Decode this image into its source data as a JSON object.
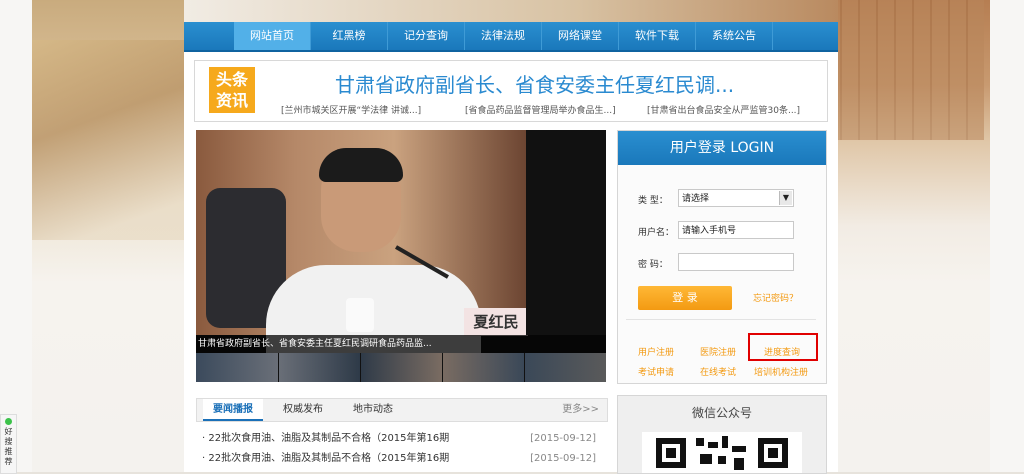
{
  "nav": {
    "items": [
      "网站首页",
      "红黑榜",
      "记分查询",
      "法律法规",
      "网络课堂",
      "软件下载",
      "系统公告"
    ],
    "active_index": 0
  },
  "headline": {
    "badge_line1": "头条",
    "badge_line2": "资讯",
    "title": "甘肃省政府副省长、省食安委主任夏红民调...",
    "subs": [
      "[兰州市城关区开展“学法律 讲诚...]",
      "[省食品药品监督管理局举办食品生...]",
      "[甘肃省出台食品安全从严监管30条...]"
    ]
  },
  "slideshow": {
    "nameplate": "夏红民",
    "caption": "甘肃省政府副省长、省食安委主任夏红民调研食品药品监..."
  },
  "news_tabs": {
    "tabs": [
      "要闻播报",
      "权威发布",
      "地市动态"
    ],
    "active_index": 0,
    "more": "更多>>",
    "items": [
      {
        "title": "· 22批次食用油、油脂及其制品不合格（2015年第16期",
        "date": "[2015-09-12]"
      },
      {
        "title": "· 22批次食用油、油脂及其制品不合格（2015年第16期",
        "date": "[2015-09-12]"
      }
    ]
  },
  "login": {
    "title": "用户登录 LOGIN",
    "type_label": "类  型：",
    "type_value": "请选择",
    "username_label": "用户名：",
    "username_value": "请输入手机号",
    "password_label": "密  码：",
    "password_value": "",
    "login_button": "登 录",
    "forgot": "忘记密码？",
    "links": {
      "user_register": "用户注册",
      "doctor_register": "医院注册",
      "progress_query": "进度查询",
      "exam_apply": "考试申请",
      "online_exam": "在线考试",
      "training_register": "培训机构注册"
    },
    "highlight_color": "#e00000"
  },
  "wechat": {
    "title": "微信公众号"
  },
  "side_badge": {
    "line1": "好",
    "line2": "搜",
    "line3": "推",
    "line4": "荐"
  },
  "colors": {
    "brand_blue": "#1a78bb",
    "accent_orange": "#f39a12"
  }
}
